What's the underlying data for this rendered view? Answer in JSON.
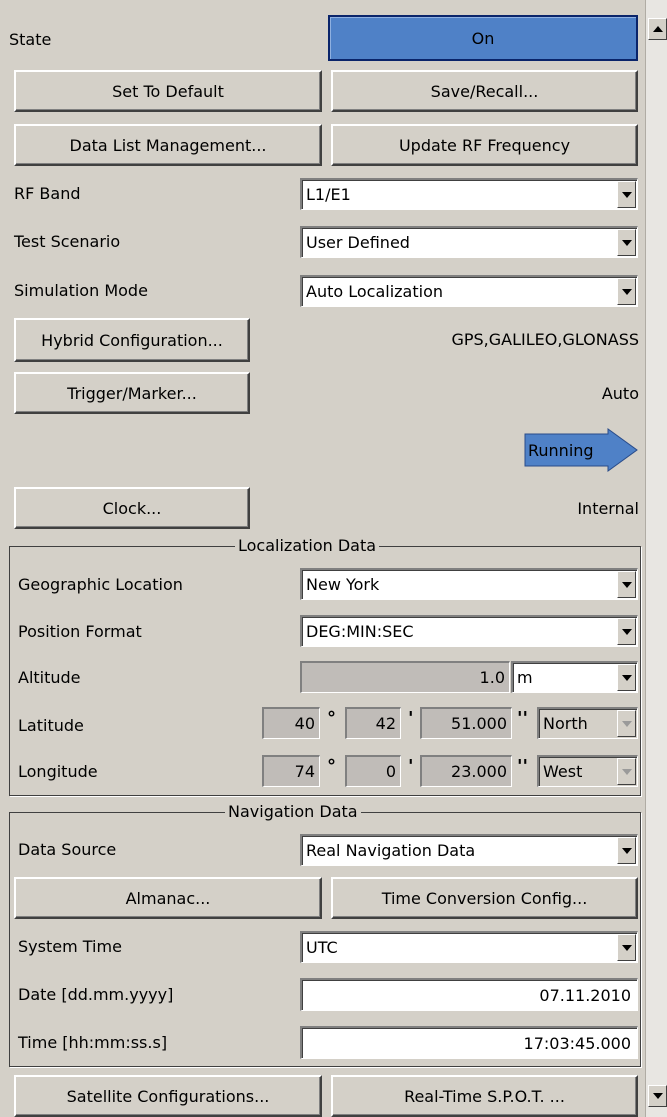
{
  "state": {
    "label": "State",
    "value": "On"
  },
  "buttons": {
    "set_default": "Set To Default",
    "save_recall": "Save/Recall...",
    "data_list": "Data List Management...",
    "update_rf": "Update RF Frequency",
    "hybrid": "Hybrid Configuration...",
    "trigger": "Trigger/Marker...",
    "clock": "Clock...",
    "almanac": "Almanac...",
    "time_conv": "Time Conversion Config...",
    "sat_config": "Satellite Configurations...",
    "realtime": "Real-Time S.P.O.T. ..."
  },
  "rf_band": {
    "label": "RF Band",
    "value": "L1/E1"
  },
  "test_scenario": {
    "label": "Test Scenario",
    "value": "User Defined"
  },
  "sim_mode": {
    "label": "Simulation Mode",
    "value": "Auto Localization"
  },
  "hybrid_value": "GPS,GALILEO,GLONASS",
  "trigger_value": "Auto",
  "running": "Running",
  "clock_value": "Internal",
  "localization": {
    "title": "Localization Data",
    "geo_label": "Geographic Location",
    "geo_value": "New York",
    "pos_label": "Position Format",
    "pos_value": "DEG:MIN:SEC",
    "alt_label": "Altitude",
    "alt_value": "1.0",
    "alt_unit": "m",
    "lat_label": "Latitude",
    "lat_deg": "40",
    "lat_min": "42",
    "lat_sec": "51.000",
    "lat_dir": "North",
    "lon_label": "Longitude",
    "lon_deg": "74",
    "lon_min": "0",
    "lon_sec": "23.000",
    "lon_dir": "West",
    "deg_sym": "°",
    "min_sym": "'",
    "sec_sym": "''"
  },
  "navigation": {
    "title": "Navigation Data",
    "source_label": "Data Source",
    "source_value": "Real Navigation Data",
    "systime_label": "System Time",
    "systime_value": "UTC",
    "date_label": "Date [dd.mm.yyyy]",
    "date_value": "07.11.2010",
    "time_label": "Time [hh:mm:ss.s]",
    "time_value": "17:03:45.000"
  },
  "colors": {
    "background": "#d4d0c8",
    "state_on": "#4f81c7",
    "running_arrow": "#4f81c7"
  }
}
